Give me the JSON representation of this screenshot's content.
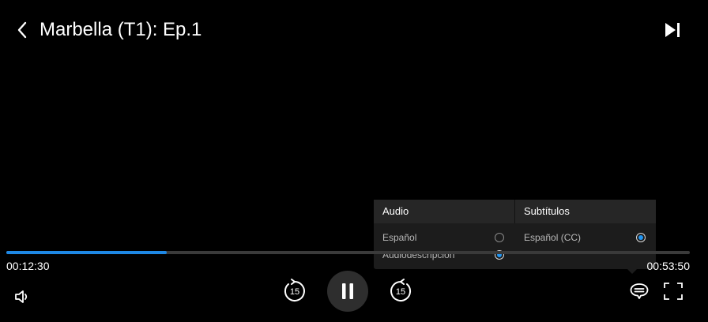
{
  "header": {
    "back_icon": "chevron-left-icon",
    "title": "Marbella (T1): Ep.1",
    "next_icon": "skip-next-icon"
  },
  "playback": {
    "elapsed": "00:12:30",
    "remaining": "00:53:50",
    "progress_fraction": 0.235,
    "accent_color": "#1e88e5"
  },
  "controls": {
    "volume_icon": "volume-icon",
    "skip_back_label": "15",
    "skip_forward_label": "15",
    "play_state": "playing",
    "pause_icon": "pause-icon",
    "subtitles_icon": "subtitles-icon",
    "fullscreen_icon": "fullscreen-icon"
  },
  "popover": {
    "audio": {
      "heading": "Audio",
      "options": [
        {
          "label": "Español",
          "selected": false
        },
        {
          "label": "Audiodescripción",
          "selected": true
        }
      ]
    },
    "subtitles": {
      "heading": "Subtítulos",
      "options": [
        {
          "label": "Español (CC)",
          "selected": true
        }
      ]
    }
  }
}
